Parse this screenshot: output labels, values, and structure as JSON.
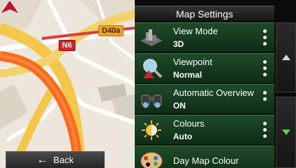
{
  "map": {
    "road_badges": [
      {
        "label": "D40a",
        "color": "#f0a020"
      },
      {
        "label": "N6",
        "color": "#d8222a"
      }
    ],
    "back_button": {
      "label": "Back",
      "icon": "arrow-left-icon"
    }
  },
  "panel": {
    "title": "Map Settings",
    "items": [
      {
        "name": "View Mode",
        "value": "3D",
        "icon": "map-3d-icon",
        "has_options": true
      },
      {
        "name": "Viewpoint",
        "value": "Normal",
        "icon": "magnifier-viewpoint-icon",
        "has_options": true
      },
      {
        "name": "Automatic Overview",
        "value": "ON",
        "icon": "binoculars-icon",
        "has_options": true
      },
      {
        "name": "Colours",
        "value": "Auto",
        "icon": "day-night-icon",
        "has_options": true
      },
      {
        "name": "Day Map Colour",
        "value": "",
        "icon": "palette-icon",
        "has_options": false
      }
    ],
    "scroll": {
      "up_icon": "chevron-up-icon",
      "down_icon": "chevron-down-icon",
      "active_color": "#4bd34b"
    }
  },
  "colors": {
    "menu_green": "#1f4a28",
    "accent_green": "#4bd34b"
  }
}
